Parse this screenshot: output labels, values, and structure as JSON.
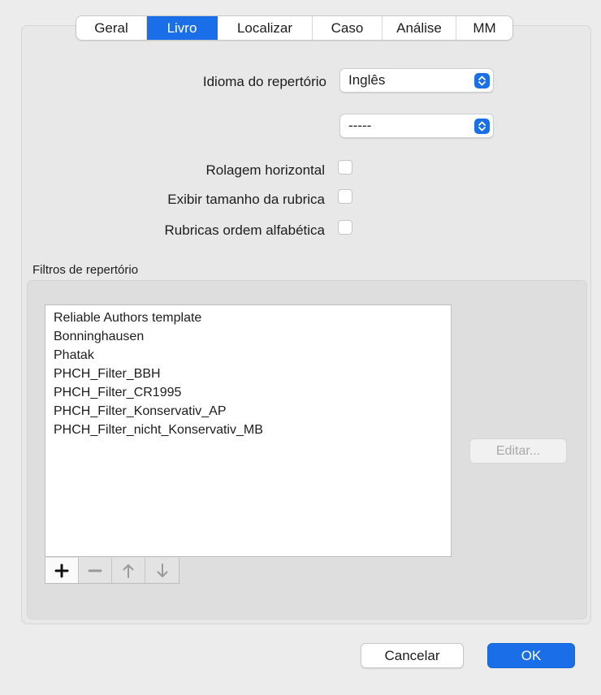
{
  "tabs": [
    {
      "label": "Geral",
      "active": false
    },
    {
      "label": "Livro",
      "active": true
    },
    {
      "label": "Localizar",
      "active": false
    },
    {
      "label": "Caso",
      "active": false
    },
    {
      "label": "Análise",
      "active": false
    },
    {
      "label": "MM",
      "active": false
    }
  ],
  "language": {
    "label": "Idioma do repertório",
    "value": "Inglês",
    "secondary_value": "-----"
  },
  "options": [
    {
      "label": "Rolagem horizontal",
      "checked": false
    },
    {
      "label": "Exibir tamanho da rubrica",
      "checked": false
    },
    {
      "label": "Rubricas ordem alfabética",
      "checked": false
    }
  ],
  "filters": {
    "title": "Filtros de repertório",
    "items": [
      "Reliable Authors template",
      "Bonninghausen",
      "Phatak",
      "PHCH_Filter_BBH",
      "PHCH_Filter_CR1995",
      "PHCH_Filter_Konservativ_AP",
      "PHCH_Filter_nicht_Konservativ_MB"
    ],
    "edit_label": "Editar...",
    "toolbar_icons": [
      "plus-icon",
      "minus-icon",
      "arrow-up-icon",
      "arrow-down-icon"
    ]
  },
  "footer": {
    "cancel_label": "Cancelar",
    "ok_label": "OK"
  },
  "colors": {
    "accent": "#1a6fe8",
    "background": "#ececec"
  }
}
